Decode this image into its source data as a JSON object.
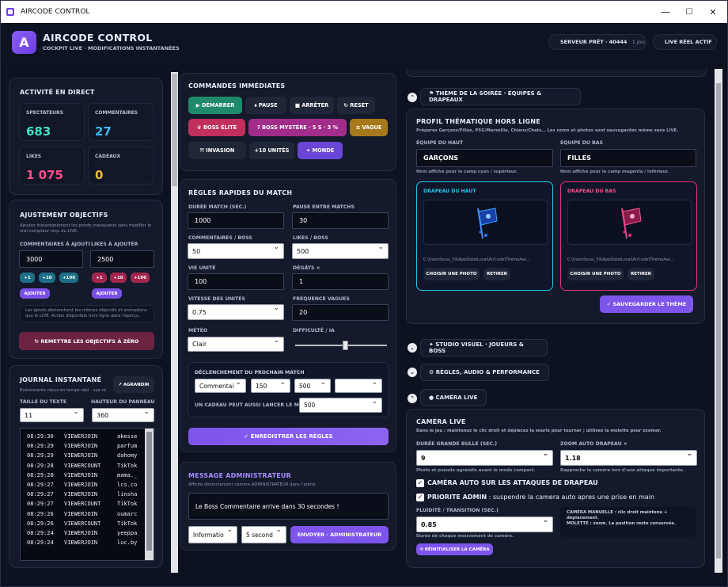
{
  "window": {
    "title": "AIRCODE CONTROL",
    "min": "—",
    "max": "☐",
    "close": "✕"
  },
  "app": {
    "logo": "A",
    "title": "AIRCODE CONTROL",
    "subtitle": "COCKPIT LIVE · MODIFICATIONS INSTANTANÉES"
  },
  "status": {
    "server": "SERVEUR PRÊT · 40444",
    "server_extra": "· 1 jou",
    "live": "LIVE RÉEL ACTIF"
  },
  "activity": {
    "title": "ACTIVITÉ EN DIRECT",
    "stats": [
      {
        "label": "SPECTATEURS",
        "value": "683",
        "color": "#3ee0c4"
      },
      {
        "label": "COMMENTAIRES",
        "value": "27",
        "color": "#3fb8ea"
      },
      {
        "label": "LIKES",
        "value": "1 075",
        "color": "#ff4f8b"
      },
      {
        "label": "CADEAUX",
        "value": "0",
        "color": "#f5b73c"
      }
    ]
  },
  "objectives": {
    "title": "AJUSTEMENT OBJECTIFS",
    "desc": "Ajoutez instantanément les points manquants sans modifier le vrai compteur reçu du LIVE.",
    "comments_label": "COMMENTAIRES À AJOUTI",
    "likes_label": "LIKES À AJOUTER",
    "comments_value": "3000",
    "likes_value": "2500",
    "plus": [
      "+1",
      "+10",
      "+100"
    ],
    "add": "AJOUTER",
    "info": "Les ajouts déclenchent les mêmes objectifs et animations que le LIVE. Action disponible hors ligne dans l'aperçu.",
    "reset": "↻ REMETTRE LES OBJECTIFS À ZÉRO"
  },
  "journal": {
    "title": "JOURNAL INSTANTANÉ",
    "desc": "Événements reçus en temps réel · vue ré",
    "expand": "↗ AGRANDIR",
    "text_size_label": "TAILLE DU TEXTE",
    "panel_height_label": "HAUTEUR DU PANNEAU",
    "text_size": "11",
    "panel_height": "360",
    "rows": [
      [
        "08:29:30",
        "VIEWERJOIN",
        "akesse"
      ],
      [
        "08:29:29",
        "VIEWERJOIN",
        "parfum"
      ],
      [
        "08:29:29",
        "VIEWERJOIN",
        "dahomy"
      ],
      [
        "08:29:28",
        "VIEWERCOUNT",
        "TikTok"
      ],
      [
        "08:29:28",
        "VIEWERJOIN",
        "mama._"
      ],
      [
        "08:29:27",
        "VIEWERJOIN",
        "lcs.co"
      ],
      [
        "08:29:27",
        "VIEWERJOIN",
        "linsha"
      ],
      [
        "08:29:27",
        "VIEWERCOUNT",
        "TikTok"
      ],
      [
        "08:29:26",
        "VIEWERJOIN",
        "oumarc"
      ],
      [
        "08:29:26",
        "VIEWERCOUNT",
        "TikTok"
      ],
      [
        "08:29:24",
        "VIEWERJOIN",
        "yeeppa"
      ],
      [
        "08:29:24",
        "VIEWERJOIN",
        "luc.by"
      ]
    ]
  },
  "commands": {
    "title": "COMMANDES IMMÉDIATES",
    "buttons": [
      {
        "label": "▶ DÉMARRER",
        "bg": "#1f8a6a"
      },
      {
        "label": "⏸ PAUSE",
        "bg": "#1f2638"
      },
      {
        "label": "■ ARRÊTER",
        "bg": "#1f2638"
      },
      {
        "label": "↻ RESET",
        "bg": "#1f2638"
      },
      {
        "label": "♛ BOSS ÉLITE",
        "bg": "#c0305a"
      },
      {
        "label": "? BOSS MYSTÈRE · 5 S · 3 %",
        "bg": "#a12c8a"
      },
      {
        "label": "≋ VAGUE",
        "bg": "#a8781c"
      },
      {
        "label": "⤧ INVASION",
        "bg": "#1f2638"
      },
      {
        "label": "+10 UNITÉS",
        "bg": "#1f2638"
      },
      {
        "label": "✦ MONDE",
        "bg": "#6a46d6"
      }
    ]
  },
  "rules": {
    "title": "RÈGLES RAPIDES DU MATCH",
    "duration_label": "DURÉE MATCH (SEC.)",
    "duration": "1000",
    "pause_label": "PAUSE ENTRE MATCHS",
    "pause": "30",
    "cpb_label": "COMMENTAIRES / BOSS",
    "cpb": "50",
    "lpb_label": "LIKES / BOSS",
    "lpb": "500",
    "life_label": "VIE UNITÉ",
    "life": "100",
    "dmg_label": "DÉGÂTS ×",
    "dmg": "1",
    "speed_label": "VITESSE DES UNITÉS",
    "speed": "0.75",
    "wave_label": "FRÉQUENCE VAGUES",
    "wave": "20",
    "weather_label": "MÉTÉO",
    "weather": "Clair",
    "difficulty_label": "DIFFICULTÉ / IA",
    "difficulty": 0.55,
    "trigger_title": "DÉCLENCHEMENT DU PROCHAIN MATCH",
    "trigger_type": "Commentai",
    "trigger_a": "150",
    "trigger_b": "500",
    "trigger_c": "",
    "gift_label": "UN CADEAU PEUT AUSSI LANCER LE MATC",
    "gift": "500",
    "save": "✓ ENREGISTRER LES RÈGLES"
  },
  "admin": {
    "title": "MESSAGE ADMINISTRATEUR",
    "desc": "Affiché distinctement comme ADMINISTRATEUR dans l'arène",
    "message": "Le Boss Commentaire arrive dans 30 secondes !",
    "type": "Informatio",
    "duration": "5 second",
    "send": "ENVOYER · ADMINISTRATEUR"
  },
  "theme": {
    "section": "⚑ THÈME DE LA SOIRÉE · ÉQUIPES & DRAPEAUX",
    "title": "PROFIL THÉMATIQUE HORS LIGNE",
    "desc": "Préparez Garçons/Filles, PSG/Marseille, Chiens/Chats… Les noms et photos sont sauvegardés même sans LIVE.",
    "top_label": "ÉQUIPE DU HAUT",
    "top": "GARÇONS",
    "top_note": "Nom affiché pour le camp cyan / supérieur.",
    "bottom_label": "ÉQUIPE DU BAS",
    "bottom": "FILLES",
    "bottom_note": "Nom affiché pour le camp magenta / inférieur.",
    "flag_top": "DRAPEAU DU HAUT",
    "flag_bottom": "DRAPEAU DU BAS",
    "path": "C:\\Users\\susu_59\\AppData\\Local\\AirCode\\ThemeAss...",
    "choose": "CHOISIR UNE PHOTO",
    "remove": "RETIRER",
    "save": "✓ SAUVEGARDER LE THÈME",
    "cyan": "#22c3e6",
    "magenta": "#e0307a"
  },
  "sections": {
    "studio": "✦ STUDIO VISUEL · JOUEURS & BOSS",
    "rules": "⚙ RÈGLES, AUDIO & PERFORMANCE",
    "camera": "● CAMÉRA LIVE"
  },
  "camera": {
    "title": "CAMÉRA LIVE",
    "desc": "Dans le jeu : maintenez le clic droit et déplacez la souris pour tourner ; utilisez la molette pour zoomer.",
    "bubble_label": "DURÉE GRANDE BULLE (SEC.)",
    "bubble": "9",
    "bubble_note": "Photo et pseudo agrandis avant le mode compact.",
    "zoom_label": "ZOOM AUTO DRAPEAU ×",
    "zoom": "1.18",
    "zoom_note": "Rapproche la caméra lors d'une attaque importante.",
    "auto": "CAMÉRA AUTO SUR LES ATTAQUES DE DRAPEAU",
    "priority_key": "PRIORITE ADMIN",
    "priority_rest": " : suspendre la camera auto apres une prise en main",
    "fluid_label": "FLUIDITÉ / TRANSITION (SEC.)",
    "fluid": "0.85",
    "fluid_note": "Durée de chaque mouvement de caméra.",
    "help": "CAMÉRA MANUELLE : clic droit maintenu + déplacement.\nMOLETTE : zoom. La position reste conservée.",
    "reset": "⟲ RÉINITIALISER LA CAMÉRA"
  }
}
